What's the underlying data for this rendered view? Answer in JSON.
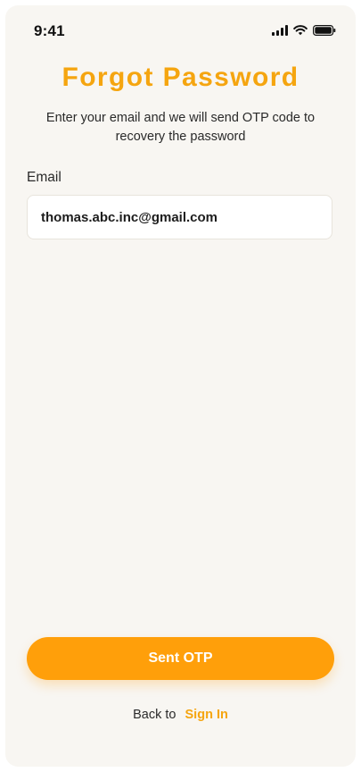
{
  "status_bar": {
    "time": "9:41",
    "icons": [
      "cellular-signal-icon",
      "wifi-icon",
      "battery-icon"
    ]
  },
  "screen": {
    "title": "Forgot Password",
    "subtitle": "Enter your email and we will send OTP code to recovery the password"
  },
  "form": {
    "email_label": "Email",
    "email_value": "thomas.abc.inc@gmail.com"
  },
  "actions": {
    "submit_label": "Sent OTP",
    "back_prefix": "Back to",
    "sign_in_label": "Sign In"
  },
  "colors": {
    "accent": "#ff9f0a",
    "title": "#f5a510",
    "background": "#f8f6f2"
  }
}
